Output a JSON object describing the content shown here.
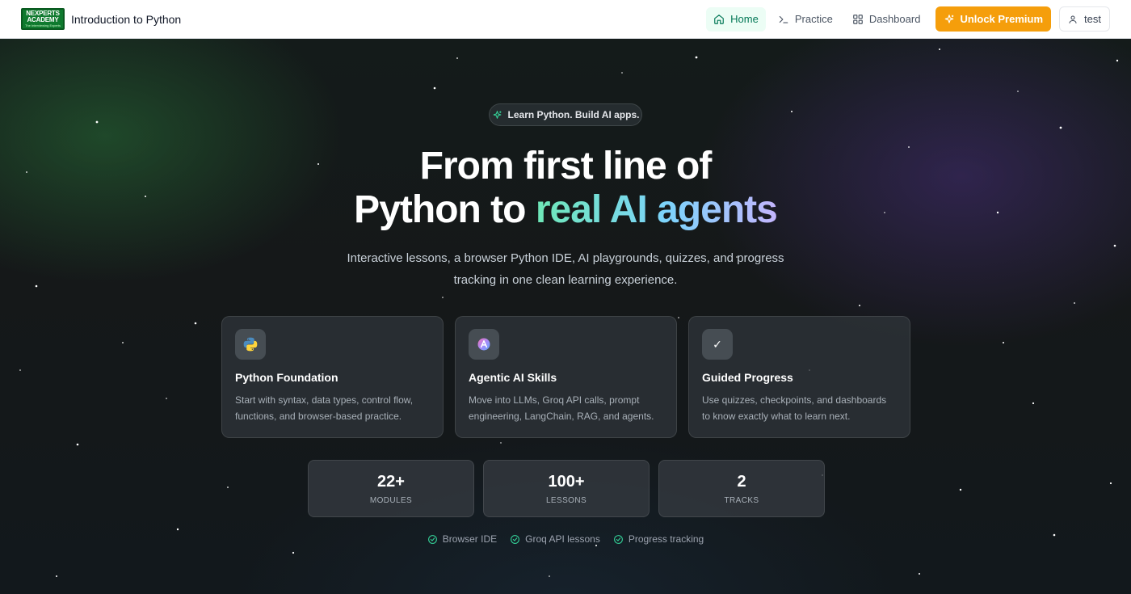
{
  "logo": {
    "line1": "NEXPERTS",
    "line2": "ACADEMY",
    "tagline": "The Interviewing Experts"
  },
  "app_title": "Introduction to Python",
  "nav": {
    "home": "Home",
    "practice": "Practice",
    "dashboard": "Dashboard",
    "premium": "Unlock Premium",
    "user": "test"
  },
  "hero": {
    "pill": "Learn Python. Build AI apps.",
    "headline_line1": "From first line of",
    "headline_line2_plain": "Python to ",
    "headline_line2_grad": "real AI agents",
    "subtitle": "Interactive lessons, a browser Python IDE, AI playgrounds, quizzes, and progress tracking in one clean learning experience."
  },
  "cards": [
    {
      "icon": "python-icon",
      "title": "Python Foundation",
      "desc": "Start with syntax, data types, control flow, functions, and browser-based practice."
    },
    {
      "icon": "agent-icon",
      "title": "Agentic AI Skills",
      "desc": "Move into LLMs, Groq API calls, prompt engineering, LangChain, RAG, and agents."
    },
    {
      "icon": "check-icon",
      "icon_glyph": "✓",
      "title": "Guided Progress",
      "desc": "Use quizzes, checkpoints, and dashboards to know exactly what to learn next."
    }
  ],
  "stats": [
    {
      "value": "22+",
      "label": "MODULES"
    },
    {
      "value": "100+",
      "label": "LESSONS"
    },
    {
      "value": "2",
      "label": "TRACKS"
    }
  ],
  "features": [
    "Browser IDE",
    "Groq API lessons",
    "Progress tracking"
  ],
  "colors": {
    "accent_green": "#047857",
    "premium": "#f59e0b",
    "check_green": "#34d399"
  }
}
